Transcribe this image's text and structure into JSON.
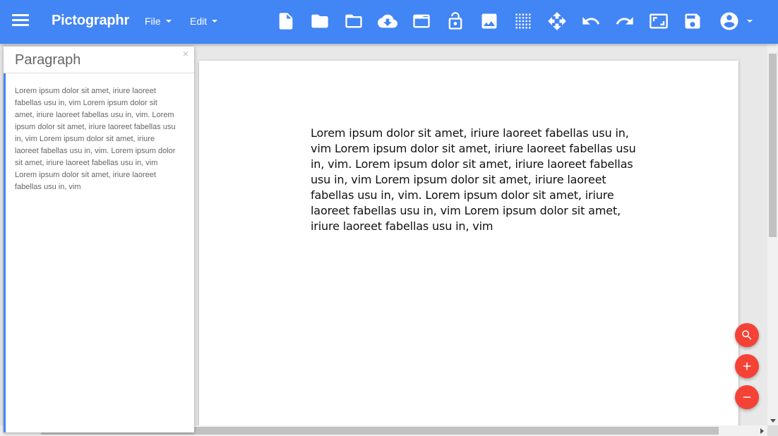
{
  "appbar": {
    "title": "Pictographr",
    "menus": [
      {
        "label": "File"
      },
      {
        "label": "Edit"
      }
    ],
    "toolbar_icons": [
      "new-document-icon",
      "open-folder-icon",
      "folder-icon",
      "cloud-download-icon",
      "window-icon",
      "lock-open-icon",
      "image-icon",
      "grid-icon",
      "move-icon",
      "undo-icon",
      "redo-icon",
      "fullscreen-icon",
      "save-icon"
    ],
    "account_icon": "account-circle-icon"
  },
  "panel": {
    "title": "Paragraph",
    "close_label": "×",
    "text": "Lorem ipsum dolor sit amet, iriure laoreet fabellas usu in, vim Lorem ipsum dolor sit amet, iriure laoreet fabellas usu in, vim. Lorem ipsum dolor sit amet, iriure laoreet fabellas usu in, vim Lorem ipsum dolor sit amet, iriure laoreet fabellas usu in, vim. Lorem ipsum dolor sit amet, iriure laoreet fabellas usu in, vim Lorem ipsum dolor sit amet, iriure laoreet fabellas usu in, vim"
  },
  "canvas": {
    "text": "Lorem ipsum dolor sit amet, iriure laoreet fabellas usu in, vim Lorem ipsum dolor sit amet, iriure laoreet fabellas usu in, vim. Lorem ipsum dolor sit amet, iriure laoreet fabellas usu in, vim Lorem ipsum dolor sit amet, iriure laoreet fabellas usu in, vim. Lorem ipsum dolor sit amet, iriure laoreet fabellas usu in, vim Lorem ipsum dolor sit amet, iriure laoreet fabellas usu in, vim"
  },
  "fabs": [
    "search-icon",
    "zoom-in-icon",
    "zoom-out-icon"
  ],
  "colors": {
    "appbar": "#4285f4",
    "accent": "#4285f4",
    "fab": "#f44336",
    "workspace": "#e8e8e8"
  }
}
